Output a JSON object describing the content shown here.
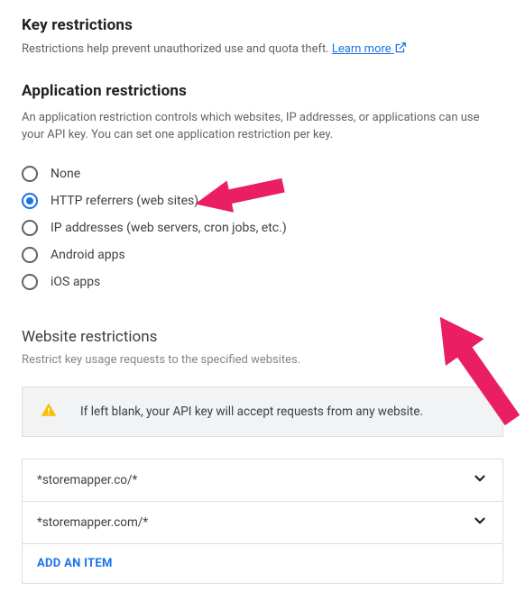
{
  "key_restrictions": {
    "title": "Key restrictions",
    "desc": "Restrictions help prevent unauthorized use and quota theft. ",
    "learn_more": "Learn more"
  },
  "app_restrictions": {
    "title": "Application restrictions",
    "desc": "An application restriction controls which websites, IP addresses, or applications can use your API key. You can set one application restriction per key.",
    "options": [
      "None",
      "HTTP referrers (web sites)",
      "IP addresses (web servers, cron jobs, etc.)",
      "Android apps",
      "iOS apps"
    ],
    "selected_index": 1
  },
  "website_restrictions": {
    "title": "Website restrictions",
    "desc": "Restrict key usage requests to the specified websites.",
    "notice": "If left blank, your API key will accept requests from any website.",
    "items": [
      "*storemapper.co/*",
      "*storemapper.com/*"
    ],
    "add_label": "ADD AN ITEM"
  },
  "colors": {
    "accent": "#1a73e8",
    "annotation": "#e91e63"
  }
}
